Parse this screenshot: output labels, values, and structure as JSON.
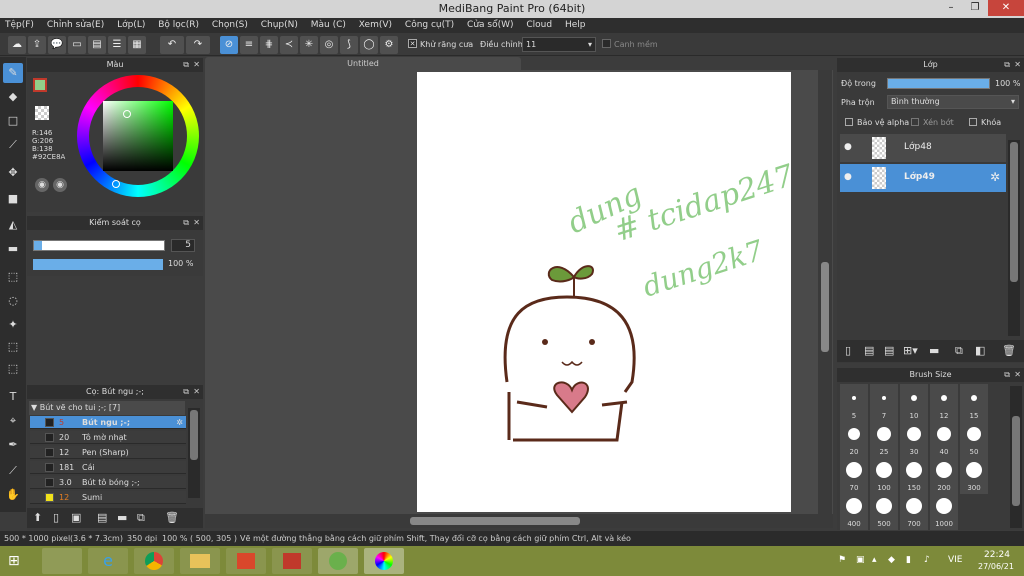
{
  "window": {
    "title": "MediBang Paint Pro (64bit)",
    "minimize": "–",
    "restore": "❐",
    "close": "✕"
  },
  "menu": [
    "Tệp(F)",
    "Chỉnh sửa(E)",
    "Lớp(L)",
    "Bộ lọc(R)",
    "Chọn(S)",
    "Chụp(N)",
    "Màu (C)",
    "Xem(V)",
    "Công cụ(T)",
    "Cửa sổ(W)",
    "Cloud",
    "Help"
  ],
  "toolbar": {
    "antialias_label": "Khử răng cưa",
    "adjust_label": "Điều chỉnh",
    "adjust_value": "11",
    "edge_label": "Canh mềm"
  },
  "color_panel": {
    "title": "Màu",
    "r": "R:146",
    "g": "G:206",
    "b": "B:138",
    "hex": "#92CE8A"
  },
  "brush_control": {
    "title": "Kiểm soát cọ",
    "size_value": "5",
    "opacity_value": "100 %"
  },
  "canvas_tab": {
    "title": "Untitled"
  },
  "brush_panel": {
    "title": "Cọ: Bút ngu ;-;",
    "group": "Bút vẽ cho tui ;-; [7]",
    "items": [
      {
        "size": "5",
        "name": "Bút ngu ;-;"
      },
      {
        "size": "20",
        "name": "Tô mờ nhạt"
      },
      {
        "size": "12",
        "name": "Pen (Sharp)"
      },
      {
        "size": "181",
        "name": "Cái"
      },
      {
        "size": "3.0",
        "name": "Bút tô bóng ;-;"
      },
      {
        "size": "12",
        "name": "Sumi"
      }
    ]
  },
  "layer_panel": {
    "title": "Lớp",
    "opacity_label": "Độ trong",
    "opacity_value": "100 %",
    "blend_label": "Pha trộn",
    "blend_value": "Bình thường",
    "protect_alpha": "Bảo vệ alpha",
    "clip": "Xén bớt",
    "lock": "Khóa",
    "layers": [
      {
        "name": "Lớp48"
      },
      {
        "name": "Lớp49"
      }
    ]
  },
  "brush_size_panel": {
    "title": "Brush Size",
    "sizes": [
      "5",
      "7",
      "10",
      "12",
      "15",
      "20",
      "25",
      "30",
      "40",
      "50",
      "70",
      "100",
      "150",
      "200",
      "300",
      "400",
      "500",
      "700",
      "1000"
    ]
  },
  "artwork": {
    "text1": "dung",
    "text2": "# tcidap247",
    "text3": "dung2k7"
  },
  "status": {
    "dims": "500 * 1000 pixel",
    "cm": "(3.6 * 7.3cm)",
    "dpi": "350 dpi",
    "zoom": "100 %",
    "coords": "( 500, 305 )",
    "hint": "Vẽ một đường thẳng bằng cách giữ phím Shift, Thay đổi cỡ cọ bằng cách giữ phím Ctrl, Alt và kéo"
  },
  "taskbar": {
    "lang": "VIE",
    "time": "22:24",
    "date": "27/06/21"
  },
  "colors": {
    "accent": "#4a90d6",
    "current_color": "#92CE8A",
    "taskbar": "#7d8a3a"
  }
}
